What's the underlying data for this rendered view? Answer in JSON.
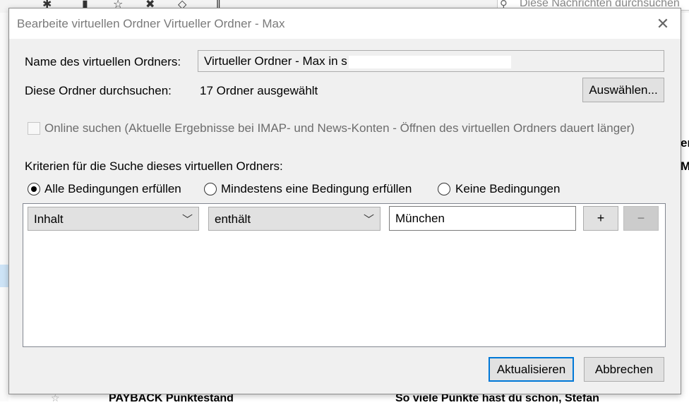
{
  "background": {
    "search_placeholder": "Diese Nachrichten durchsuchen",
    "row_subject": "PAYBACK Punktestand",
    "row_preview": "So viele Punkte hast du schon, Stefan",
    "right_fragment_1": "er",
    "right_fragment_2": "M"
  },
  "dialog": {
    "title": "Bearbeite virtuellen Ordner Virtueller Ordner - Max",
    "close_label": "✕",
    "name_label": "Name des virtuellen Ordners:",
    "name_value": "Virtueller Ordner - Max in s",
    "search_folders_label": "Diese Ordner durchsuchen:",
    "folders_selected": "17 Ordner ausgewählt",
    "choose_button": "Auswählen...",
    "online_search_label": "Online suchen (Aktuelle Ergebnisse bei IMAP- und News-Konten - Öffnen des virtuellen Ordners dauert länger)",
    "criteria_label": "Kriterien für die Suche dieses virtuellen Ordners:",
    "match_options": [
      {
        "label": "Alle Bedingungen erfüllen",
        "checked": true
      },
      {
        "label": "Mindestens eine Bedingung erfüllen",
        "checked": false
      },
      {
        "label": "Keine Bedingungen",
        "checked": false
      }
    ],
    "rules": [
      {
        "field": "Inhalt",
        "operator": "enthält",
        "value": "München",
        "add_label": "+",
        "remove_label": "−"
      }
    ],
    "update_button": "Aktualisieren",
    "cancel_button": "Abbrechen"
  },
  "colors": {
    "dialog_bg": "#f0f0f0",
    "accent": "#0078d7",
    "selection": "#cde3f6"
  }
}
